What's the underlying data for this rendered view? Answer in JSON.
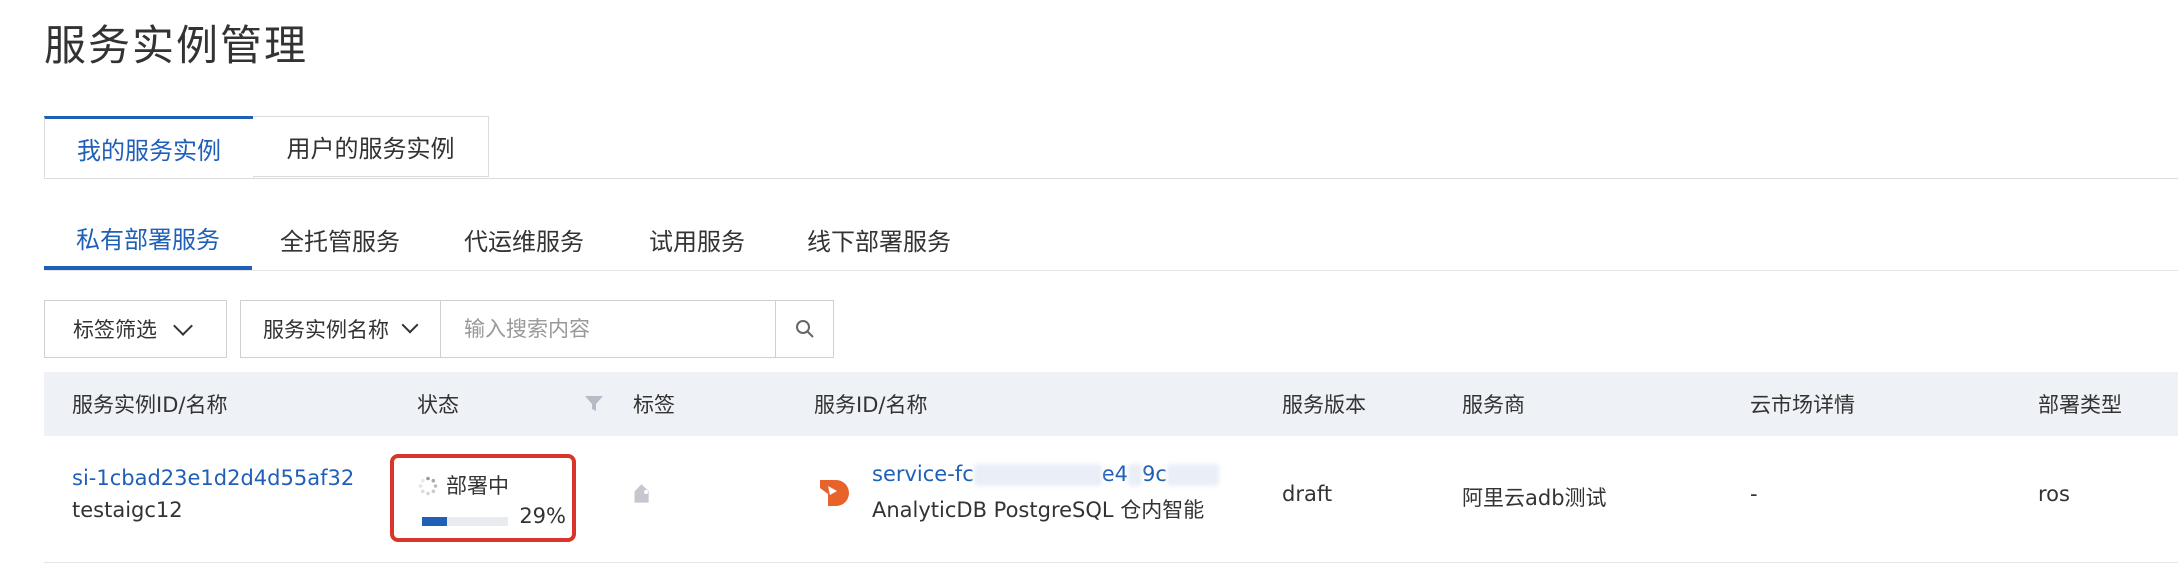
{
  "page": {
    "title": "服务实例管理"
  },
  "primary_tabs": [
    {
      "label": "我的服务实例",
      "active": true
    },
    {
      "label": "用户的服务实例",
      "active": false
    }
  ],
  "secondary_tabs": [
    {
      "label": "私有部署服务",
      "active": true
    },
    {
      "label": "全托管服务",
      "active": false
    },
    {
      "label": "代运维服务",
      "active": false
    },
    {
      "label": "试用服务",
      "active": false
    },
    {
      "label": "线下部署服务",
      "active": false
    }
  ],
  "filters": {
    "tag_filter_label": "标签筛选",
    "search_field_select": "服务实例名称",
    "search_placeholder": "输入搜索内容",
    "search_value": ""
  },
  "table": {
    "columns": [
      "服务实例ID/名称",
      "状态",
      "标签",
      "服务ID/名称",
      "服务版本",
      "服务商",
      "云市场详情",
      "部署类型"
    ],
    "rows": [
      {
        "instance_id": "si-1cbad23e1d2d4d55af32",
        "instance_name": "testaigc12",
        "status": "部署中",
        "progress_text": "29%",
        "progress": 0.29,
        "service_id_visible_start": "service-fc",
        "service_id_visible_mid": "e4",
        "service_id_visible_end": "9c",
        "service_name": "AnalyticDB PostgreSQL 仓内智能",
        "version": "draft",
        "provider": "阿里云adb测试",
        "market_detail": "-",
        "deploy_type": "ros"
      }
    ]
  },
  "colors": {
    "accent": "#1f5fb8",
    "highlight_border": "#d9352b",
    "service_logo": "#e8632b",
    "header_bg": "#eef1f6"
  },
  "icons": [
    "chevron-down-icon",
    "search-icon",
    "filter-icon",
    "tag-icon",
    "loading-spinner-icon",
    "service-logo-icon"
  ]
}
